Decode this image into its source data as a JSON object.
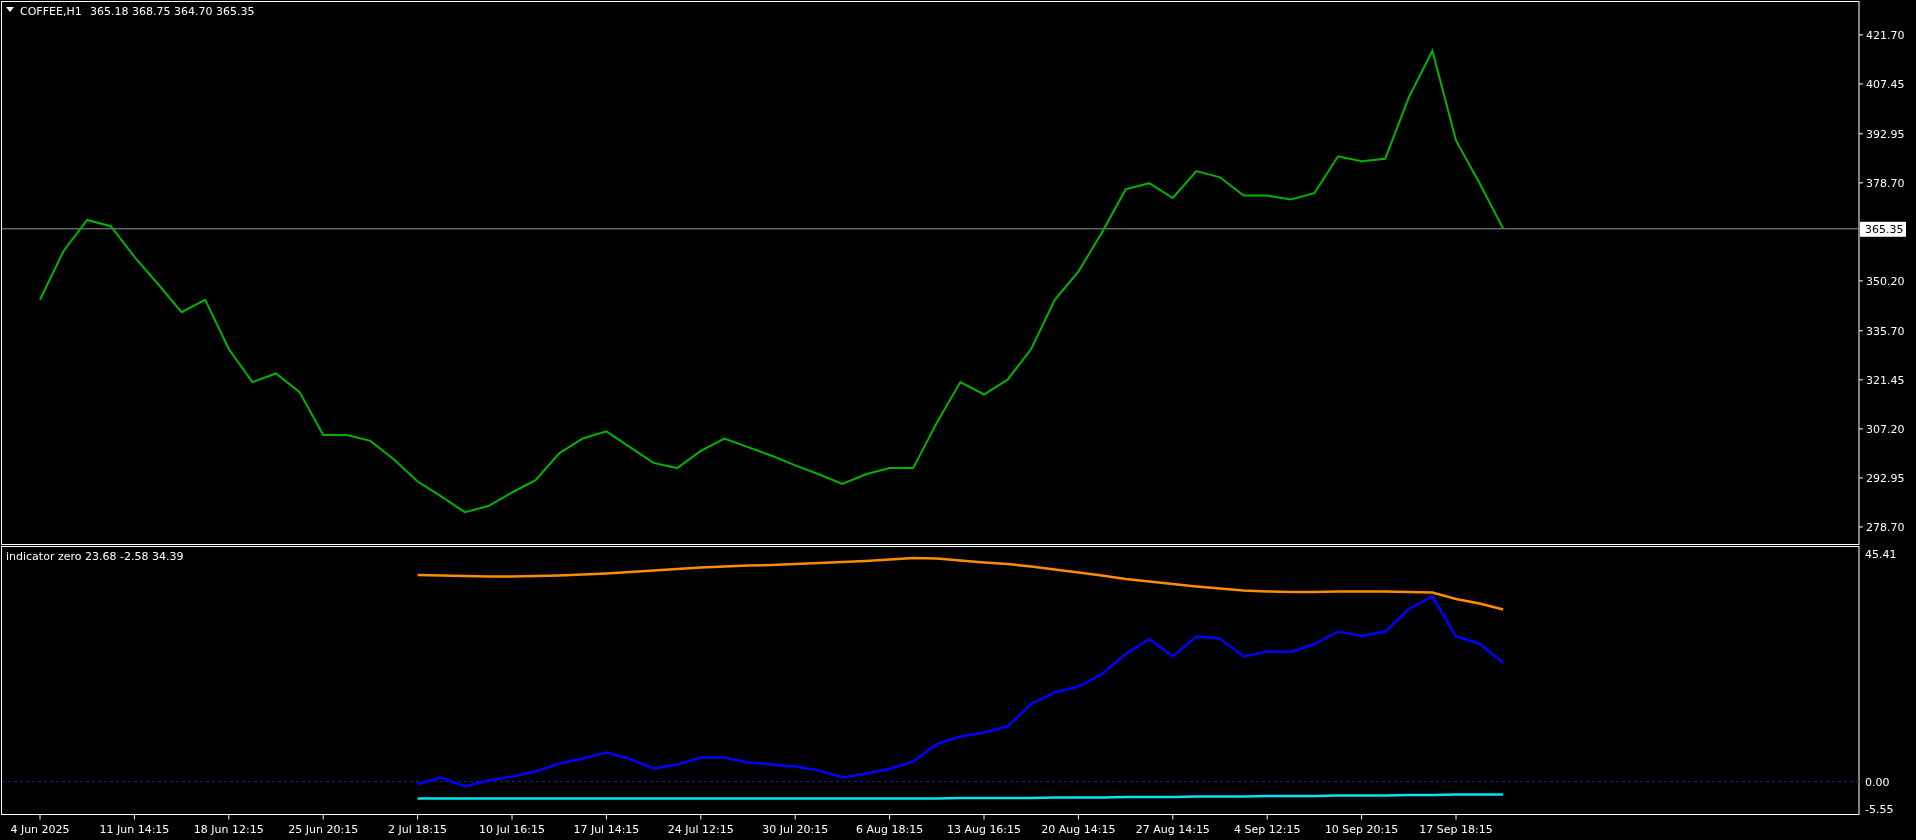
{
  "price_chart": {
    "chart_data": {
      "type": "line",
      "title": "COFFEE,H1",
      "ylim": [
        273.6,
        431.4
      ],
      "yticks": [
        {
          "value": 421.7,
          "label": "421.70"
        },
        {
          "value": 407.45,
          "label": "407.45"
        },
        {
          "value": 392.95,
          "label": "392.95"
        },
        {
          "value": 378.7,
          "label": "378.70"
        },
        {
          "value": 350.2,
          "label": "350.20"
        },
        {
          "value": 335.7,
          "label": "335.70"
        },
        {
          "value": 321.45,
          "label": "321.45"
        },
        {
          "value": 307.2,
          "label": "307.20"
        },
        {
          "value": 292.95,
          "label": "292.95"
        },
        {
          "value": 278.7,
          "label": "278.70"
        }
      ],
      "series": [
        {
          "color": "#00b400",
          "values": [
            344.7,
            358.9,
            367.9,
            366.1,
            357.2,
            349.3,
            341.1,
            344.7,
            330.4,
            320.8,
            323.3,
            317.9,
            305.4,
            305.4,
            303.7,
            298.3,
            291.9,
            287.6,
            283.0,
            284.8,
            288.7,
            292.3,
            300.1,
            304.4,
            306.5,
            301.9,
            297.3,
            295.8,
            300.8,
            304.4,
            301.9,
            299.4,
            296.6,
            294.0,
            291.2,
            294.0,
            295.8,
            295.8,
            309.0,
            320.8,
            317.2,
            321.5,
            330.4,
            344.7,
            352.9,
            364.3,
            376.8,
            378.6,
            374.3,
            382.1,
            380.3,
            375.0,
            375.0,
            373.9,
            375.7,
            386.4,
            385.0,
            385.7,
            403.5,
            417.1,
            391.0,
            378.6,
            365.4
          ]
        }
      ],
      "ref_lines": [
        {
          "axis": "y",
          "value": 365.35,
          "label": "365.35"
        }
      ]
    },
    "quote": "365.18 368.75 364.70 365.35"
  },
  "indicator": {
    "chart_data": {
      "type": "line",
      "title": "indicator zero 23.68 -2.58 34.39",
      "ylim": [
        -6.6,
        47.0
      ],
      "categories": [
        "4 Jun 2025",
        null,
        null,
        null,
        "11 Jun 14:15",
        null,
        null,
        null,
        "18 Jun 12:15",
        null,
        null,
        null,
        "25 Jun 20:15",
        null,
        null,
        null,
        "2 Jul 18:15",
        null,
        null,
        null,
        "10 Jul 16:15",
        null,
        null,
        null,
        "17 Jul 14:15",
        null,
        null,
        null,
        "24 Jul 12:15",
        null,
        null,
        null,
        "30 Jul 20:15",
        null,
        null,
        null,
        "6 Aug 18:15",
        null,
        null,
        null,
        "13 Aug 16:15",
        null,
        null,
        null,
        "20 Aug 14:15",
        null,
        null,
        null,
        "27 Aug 14:15",
        null,
        null,
        null,
        "4 Sep 12:15",
        null,
        null,
        null,
        "10 Sep 20:15",
        null,
        null,
        null,
        "17 Sep 18:15",
        null,
        null
      ],
      "yticks": [
        {
          "value": 45.41,
          "label": "45.41"
        },
        {
          "value": 0,
          "label": "0.00"
        },
        {
          "value": -5.55,
          "label": "-5.55"
        }
      ],
      "series": [
        {
          "color": "#0000ff",
          "values": [
            null,
            null,
            null,
            null,
            null,
            null,
            null,
            null,
            null,
            null,
            null,
            null,
            null,
            null,
            null,
            null,
            -0.5,
            0.8,
            -1.0,
            0.2,
            1.0,
            2.0,
            3.6,
            4.6,
            5.8,
            4.5,
            2.6,
            3.4,
            4.8,
            4.8,
            3.8,
            3.4,
            3.0,
            2.2,
            0.8,
            1.6,
            2.5,
            4.0,
            7.5,
            9.0,
            9.8,
            11.0,
            15.5,
            17.8,
            19.0,
            21.5,
            25.5,
            28.5,
            25.0,
            29.0,
            28.6,
            25.0,
            26.0,
            25.9,
            27.5,
            30.0,
            29.1,
            30.0,
            34.5,
            37.0,
            29.0,
            27.6,
            23.7
          ]
        },
        {
          "color": "#00e5ee",
          "values": [
            null,
            null,
            null,
            null,
            null,
            null,
            null,
            null,
            null,
            null,
            null,
            null,
            null,
            null,
            null,
            null,
            -3.4,
            -3.4,
            -3.4,
            -3.4,
            -3.4,
            -3.4,
            -3.4,
            -3.4,
            -3.4,
            -3.4,
            -3.4,
            -3.4,
            -3.4,
            -3.4,
            -3.4,
            -3.4,
            -3.4,
            -3.4,
            -3.4,
            -3.4,
            -3.4,
            -3.4,
            -3.4,
            -3.3,
            -3.3,
            -3.3,
            -3.3,
            -3.2,
            -3.2,
            -3.2,
            -3.1,
            -3.1,
            -3.1,
            -3.0,
            -3.0,
            -3.0,
            -2.9,
            -2.9,
            -2.9,
            -2.8,
            -2.8,
            -2.8,
            -2.7,
            -2.7,
            -2.6,
            -2.6,
            -2.6
          ]
        },
        {
          "color": "#ff8c00",
          "values": [
            null,
            null,
            null,
            null,
            null,
            null,
            null,
            null,
            null,
            null,
            null,
            null,
            null,
            null,
            null,
            null,
            41.3,
            41.2,
            41.1,
            41.0,
            41.0,
            41.1,
            41.2,
            41.4,
            41.6,
            41.9,
            42.2,
            42.5,
            42.8,
            43.0,
            43.2,
            43.3,
            43.5,
            43.7,
            43.9,
            44.1,
            44.4,
            44.7,
            44.6,
            44.2,
            43.8,
            43.5,
            43.0,
            42.4,
            41.8,
            41.2,
            40.5,
            40.0,
            39.5,
            39.0,
            38.6,
            38.2,
            38.0,
            37.9,
            37.9,
            38.0,
            38.0,
            38.0,
            37.9,
            37.8,
            36.5,
            35.6,
            34.4
          ]
        }
      ],
      "ref_lines": [
        {
          "axis": "y",
          "value": 0
        }
      ]
    }
  }
}
